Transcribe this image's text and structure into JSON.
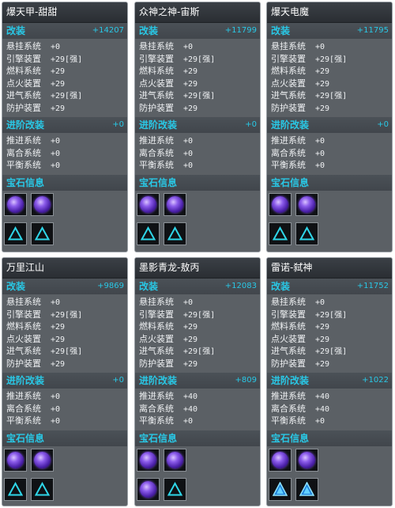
{
  "cards": [
    {
      "title": "爆天甲-甜甜",
      "mod_label": "改装",
      "mod_value": "+14207",
      "mods": [
        {
          "name": "悬挂系统",
          "value": "+0"
        },
        {
          "name": "引擎装置",
          "value": "+29[强]"
        },
        {
          "name": "燃料系统",
          "value": "+29"
        },
        {
          "name": "点火装置",
          "value": "+29"
        },
        {
          "name": "进气系统",
          "value": "+29[强]"
        },
        {
          "name": "防护装置",
          "value": "+29"
        }
      ],
      "adv_label": "进阶改装",
      "adv_value": "+0",
      "advs": [
        {
          "name": "推进系统",
          "value": "+0"
        },
        {
          "name": "离合系统",
          "value": "+0"
        },
        {
          "name": "平衡系统",
          "value": "+0"
        }
      ],
      "gem_label": "宝石信息",
      "gems_top": [
        "purple-gem-icon",
        "purple-gem-icon"
      ],
      "gems_bottom": [
        "triangle-slot-icon",
        "triangle-slot-icon"
      ]
    },
    {
      "title": "众神之神-宙斯",
      "mod_label": "改装",
      "mod_value": "+11799",
      "mods": [
        {
          "name": "悬挂系统",
          "value": "+0"
        },
        {
          "name": "引擎装置",
          "value": "+29[强]"
        },
        {
          "name": "燃料系统",
          "value": "+29"
        },
        {
          "name": "点火装置",
          "value": "+29"
        },
        {
          "name": "进气系统",
          "value": "+29[强]"
        },
        {
          "name": "防护装置",
          "value": "+29"
        }
      ],
      "adv_label": "进阶改装",
      "adv_value": "+0",
      "advs": [
        {
          "name": "推进系统",
          "value": "+0"
        },
        {
          "name": "离合系统",
          "value": "+0"
        },
        {
          "name": "平衡系统",
          "value": "+0"
        }
      ],
      "gem_label": "宝石信息",
      "gems_top": [
        "purple-gem-icon",
        "purple-gem-icon"
      ],
      "gems_bottom": [
        "triangle-slot-icon",
        "triangle-slot-icon"
      ]
    },
    {
      "title": "爆天电魔",
      "mod_label": "改装",
      "mod_value": "+11795",
      "mods": [
        {
          "name": "悬挂系统",
          "value": "+0"
        },
        {
          "name": "引擎装置",
          "value": "+29[强]"
        },
        {
          "name": "燃料系统",
          "value": "+29"
        },
        {
          "name": "点火装置",
          "value": "+29"
        },
        {
          "name": "进气系统",
          "value": "+29[强]"
        },
        {
          "name": "防护装置",
          "value": "+29"
        }
      ],
      "adv_label": "进阶改装",
      "adv_value": "+0",
      "advs": [
        {
          "name": "推进系统",
          "value": "+0"
        },
        {
          "name": "离合系统",
          "value": "+0"
        },
        {
          "name": "平衡系统",
          "value": "+0"
        }
      ],
      "gem_label": "宝石信息",
      "gems_top": [
        "purple-gem-icon",
        "purple-gem-icon"
      ],
      "gems_bottom": [
        "triangle-slot-icon",
        "triangle-slot-icon"
      ]
    },
    {
      "title": "万里江山",
      "mod_label": "改装",
      "mod_value": "+9869",
      "mods": [
        {
          "name": "悬挂系统",
          "value": "+0"
        },
        {
          "name": "引擎装置",
          "value": "+29[强]"
        },
        {
          "name": "燃料系统",
          "value": "+29"
        },
        {
          "name": "点火装置",
          "value": "+29"
        },
        {
          "name": "进气系统",
          "value": "+29[强]"
        },
        {
          "name": "防护装置",
          "value": "+29"
        }
      ],
      "adv_label": "进阶改装",
      "adv_value": "+0",
      "advs": [
        {
          "name": "推进系统",
          "value": "+0"
        },
        {
          "name": "离合系统",
          "value": "+0"
        },
        {
          "name": "平衡系统",
          "value": "+0"
        }
      ],
      "gem_label": "宝石信息",
      "gems_top": [
        "purple-gem-icon",
        "purple-gem-icon"
      ],
      "gems_bottom": [
        "triangle-slot-icon",
        "triangle-slot-icon"
      ]
    },
    {
      "title": "墨影青龙-敖丙",
      "mod_label": "改装",
      "mod_value": "+12083",
      "mods": [
        {
          "name": "悬挂系统",
          "value": "+0"
        },
        {
          "name": "引擎装置",
          "value": "+29[强]"
        },
        {
          "name": "燃料系统",
          "value": "+29"
        },
        {
          "name": "点火装置",
          "value": "+29"
        },
        {
          "name": "进气系统",
          "value": "+29[强]"
        },
        {
          "name": "防护装置",
          "value": "+29"
        }
      ],
      "adv_label": "进阶改装",
      "adv_value": "+809",
      "advs": [
        {
          "name": "推进系统",
          "value": "+40"
        },
        {
          "name": "离合系统",
          "value": "+40"
        },
        {
          "name": "平衡系统",
          "value": "+0"
        }
      ],
      "gem_label": "宝石信息",
      "gems_top": [
        "purple-gem-icon",
        "purple-gem-icon"
      ],
      "gems_bottom": [
        "purple-gem-icon",
        "triangle-slot-icon"
      ]
    },
    {
      "title": "雷诺-弑神",
      "mod_label": "改装",
      "mod_value": "+11752",
      "mods": [
        {
          "name": "悬挂系统",
          "value": "+0"
        },
        {
          "name": "引擎装置",
          "value": "+29[强]"
        },
        {
          "name": "燃料系统",
          "value": "+29"
        },
        {
          "name": "点火装置",
          "value": "+29"
        },
        {
          "name": "进气系统",
          "value": "+29[强]"
        },
        {
          "name": "防护装置",
          "value": "+29"
        }
      ],
      "adv_label": "进阶改装",
      "adv_value": "+1022",
      "advs": [
        {
          "name": "推进系统",
          "value": "+40"
        },
        {
          "name": "离合系统",
          "value": "+40"
        },
        {
          "name": "平衡系统",
          "value": "+0"
        }
      ],
      "gem_label": "宝石信息",
      "gems_top": [
        "purple-gem-icon",
        "purple-gem-icon"
      ],
      "gems_bottom": [
        "blue-triangle-gem-icon",
        "blue-triangle-gem-icon"
      ]
    }
  ]
}
